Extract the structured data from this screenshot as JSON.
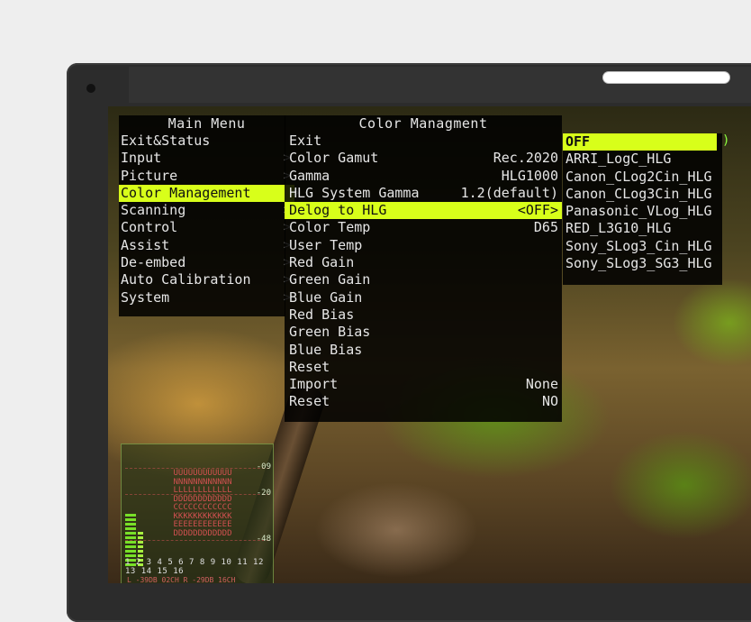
{
  "main_menu": {
    "title": "Main Menu",
    "items": [
      {
        "label": "Exit&Status",
        "has_submenu": false
      },
      {
        "label": "Input",
        "has_submenu": true
      },
      {
        "label": "Picture",
        "has_submenu": true
      },
      {
        "label": "Color Management",
        "has_submenu": true,
        "selected": true
      },
      {
        "label": "Scanning",
        "has_submenu": true
      },
      {
        "label": "Control",
        "has_submenu": true
      },
      {
        "label": "Assist",
        "has_submenu": true
      },
      {
        "label": "De-embed",
        "has_submenu": true
      },
      {
        "label": "Auto Calibration",
        "has_submenu": true
      },
      {
        "label": "System",
        "has_submenu": true
      }
    ],
    "arrow_glyph": ">"
  },
  "color_menu": {
    "title": "Color Managment",
    "items": [
      {
        "label": "Exit",
        "value": ""
      },
      {
        "label": "Color Gamut",
        "value": "Rec.2020"
      },
      {
        "label": "Gamma",
        "value": "HLG1000"
      },
      {
        "label": "HLG System Gamma",
        "value": "1.2(default)"
      },
      {
        "label": "Delog to HLG",
        "value": "<OFF>",
        "selected": true
      },
      {
        "label": "Color Temp",
        "value": "D65"
      },
      {
        "label": "User Temp",
        "value": ""
      },
      {
        "label": "Red Gain",
        "value": ""
      },
      {
        "label": "Green Gain",
        "value": ""
      },
      {
        "label": "Blue Gain",
        "value": ""
      },
      {
        "label": "Red Bias",
        "value": ""
      },
      {
        "label": "Green Bias",
        "value": ""
      },
      {
        "label": "Blue Bias",
        "value": ""
      },
      {
        "label": "Reset",
        "value": ""
      },
      {
        "label": "Import",
        "value": "None"
      },
      {
        "label": "Reset",
        "value": "NO"
      }
    ]
  },
  "delog_options": [
    {
      "label": "OFF",
      "selected": true
    },
    {
      "label": "ARRI_LogC_HLG"
    },
    {
      "label": "Canon_CLog2Cin_HLG"
    },
    {
      "label": "Canon_CLog3Cin_HLG"
    },
    {
      "label": "Panasonic_VLog_HLG"
    },
    {
      "label": "RED_L3G10_HLG"
    },
    {
      "label": "Sony_SLog3_Cin_HLG"
    },
    {
      "label": "Sony_SLog3_SG3_HLG"
    }
  ],
  "audio_meter": {
    "scale_labels": [
      "-09",
      "-20",
      "-48"
    ],
    "channels": "1 2 3 4 5 6 7 8 9 10 11 12 13 14 15 16",
    "info": "L -39DB 02CH    R -29DB 16CH"
  },
  "colors": {
    "highlight": "#d8ff1a",
    "menu_background": "#000000",
    "menu_text": "#e6e6e6",
    "bezel": "#2c2c2c"
  }
}
